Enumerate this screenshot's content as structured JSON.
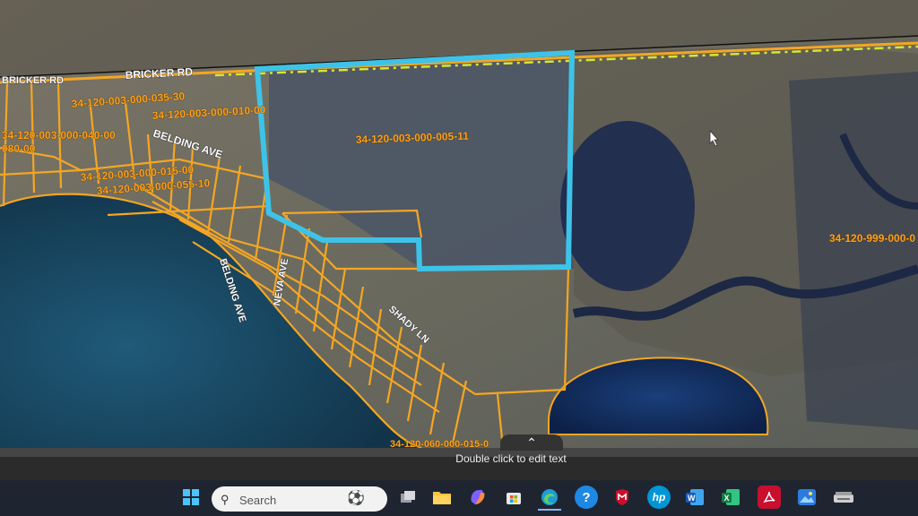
{
  "map": {
    "roads": [
      "BRICKER RD",
      "BRICKER RD",
      "BELDING AVE",
      "BELDING AVE",
      "NEVA AVE",
      "SHADY LN"
    ],
    "parcels": [
      "34-120-003-000-035-30",
      "34-120-003-000-010-00",
      "34-120-003-000-040-00",
      "080-00",
      "34-120-003-000-015-00",
      "34-120-003-000-055-10",
      "34-120-003-000-005-11",
      "34-120-999-000-0",
      "34-120-060-000-015-0"
    ],
    "colors": {
      "parcel_line": "#f5a623",
      "selection": "#3ec3e8",
      "water": "#1c4f6e",
      "land": "#6d6a5c"
    }
  },
  "status": {
    "message": "Double click to edit text"
  },
  "taskbar": {
    "search_placeholder": "Search",
    "icons": [
      "windows-icon",
      "task-view-icon",
      "file-explorer-icon",
      "copilot-icon",
      "ms-store-icon",
      "edge-icon",
      "help-icon",
      "mcafee-icon",
      "hp-icon",
      "word-icon",
      "excel-icon",
      "acrobat-icon",
      "photos-icon",
      "scanner-icon"
    ]
  }
}
